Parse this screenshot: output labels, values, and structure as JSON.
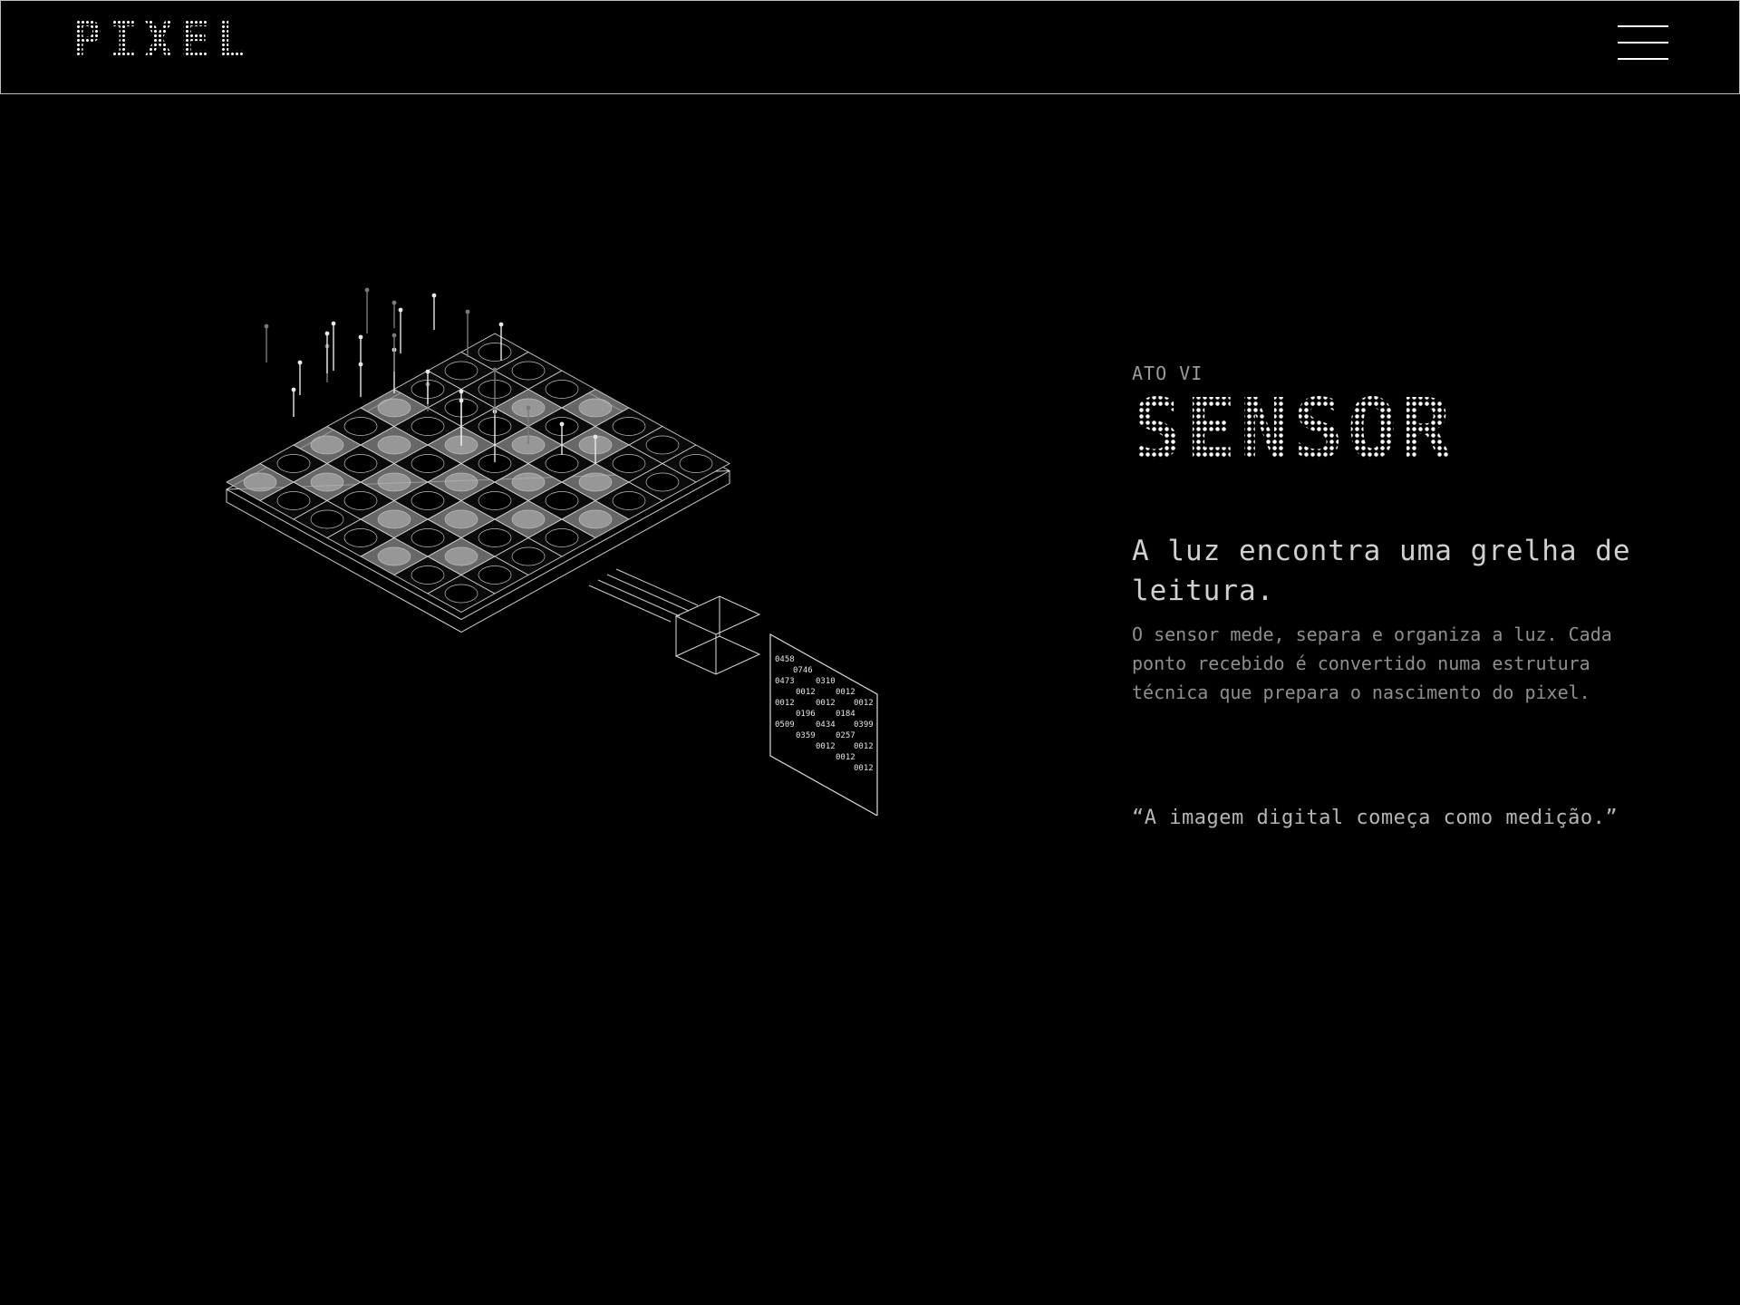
{
  "header": {
    "logo": "PIXEL",
    "menu_icon": "hamburger-menu-icon"
  },
  "illustration": {
    "readout_values": [
      "0458",
      "0746",
      "0473",
      "0310",
      "0012",
      "0012",
      "0012",
      "0012",
      "0012",
      "0196",
      "0184",
      "0509",
      "0434",
      "0399",
      "0359",
      "0257",
      "0012",
      "0012",
      "0012",
      "0012"
    ]
  },
  "section": {
    "kicker": "ATO VI",
    "title": "SENSOR",
    "lead": "A luz encontra uma grelha de leitura.",
    "body": "O sensor mede, separa e organiza a luz. Cada ponto recebido é convertido numa estrutura técnica que prepara o nascimento do pixel.",
    "quote": "“A imagem digital começa como medição.”"
  }
}
